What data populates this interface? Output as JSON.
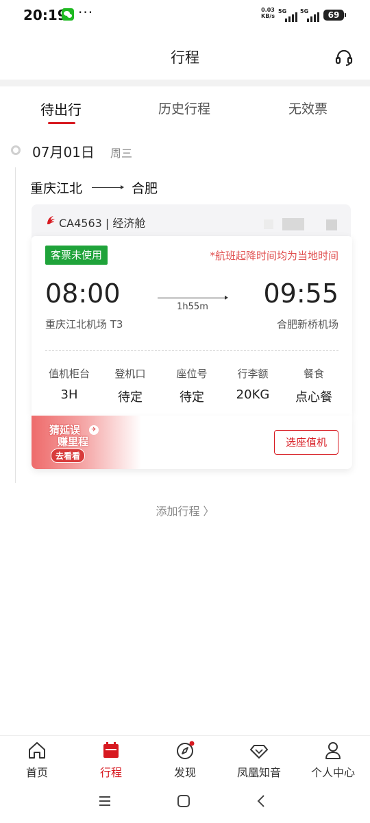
{
  "status_bar": {
    "time": "20:19",
    "more": "···",
    "net_speed": "0.03",
    "net_unit": "KB/s",
    "sig1_label": "5G",
    "sig2_label": "5G",
    "battery": "69"
  },
  "header": {
    "title": "行程"
  },
  "tabs": [
    {
      "label": "待出行"
    },
    {
      "label": "历史行程"
    },
    {
      "label": "无效票"
    }
  ],
  "trip": {
    "date": "07月01日",
    "weekday": "周三",
    "from_city": "重庆江北",
    "to_city": "合肥",
    "flight": "CA4563 | 经济舱",
    "status": "客票未使用",
    "local_note": "*航班起降时间均为当地时间",
    "dep_time": "08:00",
    "arr_time": "09:55",
    "duration": "1h55m",
    "dep_airport": "重庆江北机场 T3",
    "arr_airport": "合肥新桥机场",
    "info": [
      {
        "label": "值机柜台",
        "value": "3H"
      },
      {
        "label": "登机口",
        "value": "待定"
      },
      {
        "label": "座位号",
        "value": "待定"
      },
      {
        "label": "行李额",
        "value": "20KG"
      },
      {
        "label": "餐食",
        "value": "点心餐"
      }
    ],
    "promo_line1": "猜延误",
    "promo_line2": "赚里程",
    "promo_cta": "去看看",
    "checkin_button": "选座值机"
  },
  "add_trip": "添加行程 〉",
  "bottom_nav": [
    {
      "label": "首页",
      "icon": "home-icon"
    },
    {
      "label": "行程",
      "icon": "calendar-icon"
    },
    {
      "label": "发现",
      "icon": "compass-icon"
    },
    {
      "label": "凤凰知音",
      "icon": "diamond-icon"
    },
    {
      "label": "个人中心",
      "icon": "person-icon"
    }
  ],
  "colors": {
    "accent": "#d71920",
    "status_green": "#1fa33a",
    "note_red": "#e05050"
  }
}
